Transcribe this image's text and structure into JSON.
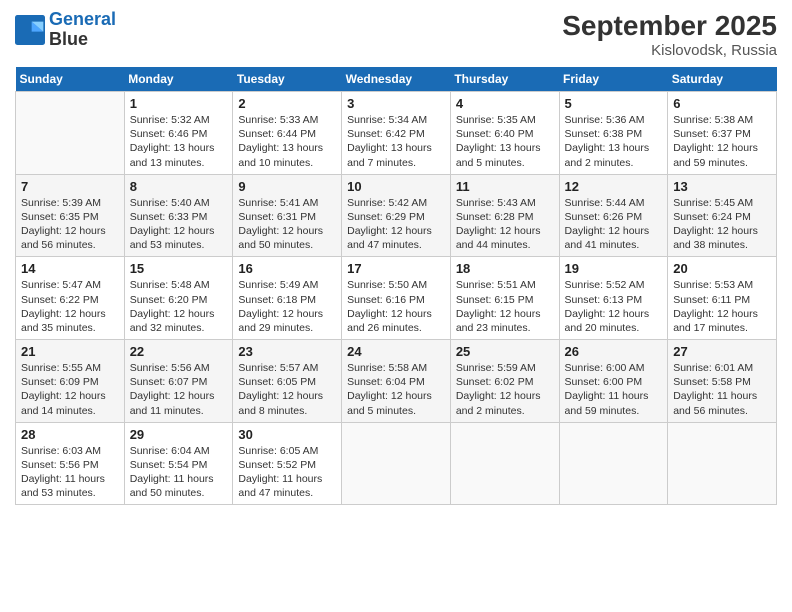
{
  "header": {
    "logo_line1": "General",
    "logo_line2": "Blue",
    "month_title": "September 2025",
    "location": "Kislovodsk, Russia"
  },
  "columns": [
    "Sunday",
    "Monday",
    "Tuesday",
    "Wednesday",
    "Thursday",
    "Friday",
    "Saturday"
  ],
  "weeks": [
    [
      {
        "day": "",
        "empty": true
      },
      {
        "day": "1",
        "sunrise": "Sunrise: 5:32 AM",
        "sunset": "Sunset: 6:46 PM",
        "daylight": "Daylight: 13 hours and 13 minutes."
      },
      {
        "day": "2",
        "sunrise": "Sunrise: 5:33 AM",
        "sunset": "Sunset: 6:44 PM",
        "daylight": "Daylight: 13 hours and 10 minutes."
      },
      {
        "day": "3",
        "sunrise": "Sunrise: 5:34 AM",
        "sunset": "Sunset: 6:42 PM",
        "daylight": "Daylight: 13 hours and 7 minutes."
      },
      {
        "day": "4",
        "sunrise": "Sunrise: 5:35 AM",
        "sunset": "Sunset: 6:40 PM",
        "daylight": "Daylight: 13 hours and 5 minutes."
      },
      {
        "day": "5",
        "sunrise": "Sunrise: 5:36 AM",
        "sunset": "Sunset: 6:38 PM",
        "daylight": "Daylight: 13 hours and 2 minutes."
      },
      {
        "day": "6",
        "sunrise": "Sunrise: 5:38 AM",
        "sunset": "Sunset: 6:37 PM",
        "daylight": "Daylight: 12 hours and 59 minutes."
      }
    ],
    [
      {
        "day": "7",
        "sunrise": "Sunrise: 5:39 AM",
        "sunset": "Sunset: 6:35 PM",
        "daylight": "Daylight: 12 hours and 56 minutes."
      },
      {
        "day": "8",
        "sunrise": "Sunrise: 5:40 AM",
        "sunset": "Sunset: 6:33 PM",
        "daylight": "Daylight: 12 hours and 53 minutes."
      },
      {
        "day": "9",
        "sunrise": "Sunrise: 5:41 AM",
        "sunset": "Sunset: 6:31 PM",
        "daylight": "Daylight: 12 hours and 50 minutes."
      },
      {
        "day": "10",
        "sunrise": "Sunrise: 5:42 AM",
        "sunset": "Sunset: 6:29 PM",
        "daylight": "Daylight: 12 hours and 47 minutes."
      },
      {
        "day": "11",
        "sunrise": "Sunrise: 5:43 AM",
        "sunset": "Sunset: 6:28 PM",
        "daylight": "Daylight: 12 hours and 44 minutes."
      },
      {
        "day": "12",
        "sunrise": "Sunrise: 5:44 AM",
        "sunset": "Sunset: 6:26 PM",
        "daylight": "Daylight: 12 hours and 41 minutes."
      },
      {
        "day": "13",
        "sunrise": "Sunrise: 5:45 AM",
        "sunset": "Sunset: 6:24 PM",
        "daylight": "Daylight: 12 hours and 38 minutes."
      }
    ],
    [
      {
        "day": "14",
        "sunrise": "Sunrise: 5:47 AM",
        "sunset": "Sunset: 6:22 PM",
        "daylight": "Daylight: 12 hours and 35 minutes."
      },
      {
        "day": "15",
        "sunrise": "Sunrise: 5:48 AM",
        "sunset": "Sunset: 6:20 PM",
        "daylight": "Daylight: 12 hours and 32 minutes."
      },
      {
        "day": "16",
        "sunrise": "Sunrise: 5:49 AM",
        "sunset": "Sunset: 6:18 PM",
        "daylight": "Daylight: 12 hours and 29 minutes."
      },
      {
        "day": "17",
        "sunrise": "Sunrise: 5:50 AM",
        "sunset": "Sunset: 6:16 PM",
        "daylight": "Daylight: 12 hours and 26 minutes."
      },
      {
        "day": "18",
        "sunrise": "Sunrise: 5:51 AM",
        "sunset": "Sunset: 6:15 PM",
        "daylight": "Daylight: 12 hours and 23 minutes."
      },
      {
        "day": "19",
        "sunrise": "Sunrise: 5:52 AM",
        "sunset": "Sunset: 6:13 PM",
        "daylight": "Daylight: 12 hours and 20 minutes."
      },
      {
        "day": "20",
        "sunrise": "Sunrise: 5:53 AM",
        "sunset": "Sunset: 6:11 PM",
        "daylight": "Daylight: 12 hours and 17 minutes."
      }
    ],
    [
      {
        "day": "21",
        "sunrise": "Sunrise: 5:55 AM",
        "sunset": "Sunset: 6:09 PM",
        "daylight": "Daylight: 12 hours and 14 minutes."
      },
      {
        "day": "22",
        "sunrise": "Sunrise: 5:56 AM",
        "sunset": "Sunset: 6:07 PM",
        "daylight": "Daylight: 12 hours and 11 minutes."
      },
      {
        "day": "23",
        "sunrise": "Sunrise: 5:57 AM",
        "sunset": "Sunset: 6:05 PM",
        "daylight": "Daylight: 12 hours and 8 minutes."
      },
      {
        "day": "24",
        "sunrise": "Sunrise: 5:58 AM",
        "sunset": "Sunset: 6:04 PM",
        "daylight": "Daylight: 12 hours and 5 minutes."
      },
      {
        "day": "25",
        "sunrise": "Sunrise: 5:59 AM",
        "sunset": "Sunset: 6:02 PM",
        "daylight": "Daylight: 12 hours and 2 minutes."
      },
      {
        "day": "26",
        "sunrise": "Sunrise: 6:00 AM",
        "sunset": "Sunset: 6:00 PM",
        "daylight": "Daylight: 11 hours and 59 minutes."
      },
      {
        "day": "27",
        "sunrise": "Sunrise: 6:01 AM",
        "sunset": "Sunset: 5:58 PM",
        "daylight": "Daylight: 11 hours and 56 minutes."
      }
    ],
    [
      {
        "day": "28",
        "sunrise": "Sunrise: 6:03 AM",
        "sunset": "Sunset: 5:56 PM",
        "daylight": "Daylight: 11 hours and 53 minutes."
      },
      {
        "day": "29",
        "sunrise": "Sunrise: 6:04 AM",
        "sunset": "Sunset: 5:54 PM",
        "daylight": "Daylight: 11 hours and 50 minutes."
      },
      {
        "day": "30",
        "sunrise": "Sunrise: 6:05 AM",
        "sunset": "Sunset: 5:52 PM",
        "daylight": "Daylight: 11 hours and 47 minutes."
      },
      {
        "day": "",
        "empty": true
      },
      {
        "day": "",
        "empty": true
      },
      {
        "day": "",
        "empty": true
      },
      {
        "day": "",
        "empty": true
      }
    ]
  ]
}
